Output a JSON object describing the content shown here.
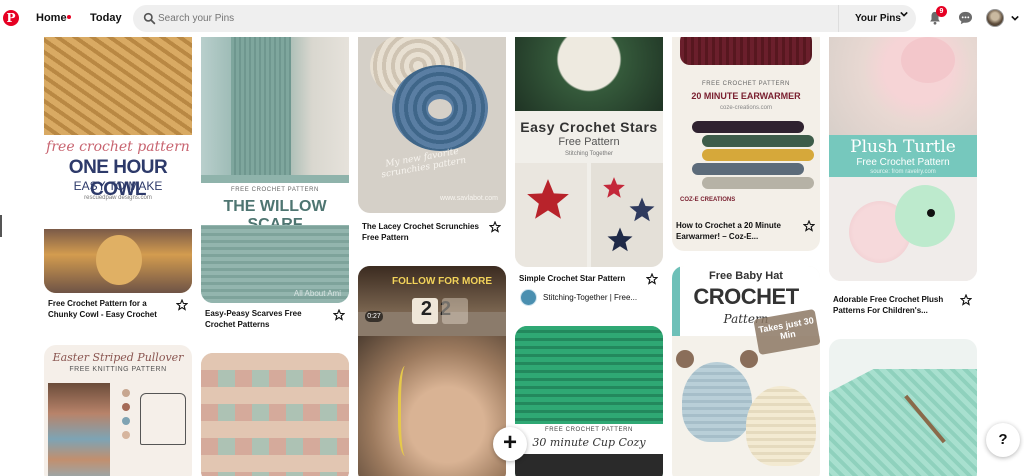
{
  "header": {
    "logo": "P",
    "home_label": "Home",
    "today_label": "Today",
    "search_placeholder": "Search your Pins",
    "your_pins_label": "Your Pins",
    "notification_count": "9"
  },
  "pins": [
    {
      "img_title1": "free crochet pattern",
      "img_title2": "ONE HOUR COWL",
      "img_title3": "EASY TO MAKE",
      "img_source": "rescuedpaw designs.com",
      "caption": "Free Crochet Pattern for a Chunky Cowl - Easy Crochet"
    },
    {
      "img_tag": "FREE CROCHET PATTERN",
      "img_title": "THE WILLOW SCARF",
      "img_watermark": "All About Ami",
      "caption": "Easy-Peasy Scarves Free Crochet Patterns"
    },
    {
      "img_script": "My new favorite scrunchies pattern",
      "img_url": "www.savlabot.com",
      "caption": "The Lacey Crochet Scrunchies Free Pattern"
    },
    {
      "img_title": "Easy Crochet Stars",
      "img_sub1": "Free Pattern",
      "img_sub2": "Stitching Together",
      "caption": "Simple Crochet Star Pattern",
      "board": "Stitching-Together | Free..."
    },
    {
      "img_tag": "FREE CROCHET PATTERN",
      "img_title": "20 MINUTE EARWARMER",
      "img_url": "coze-creations.com",
      "img_brand": "COZ-E CREATIONS",
      "caption": "How to Crochet a 20 Minute Earwarmer! – Coz-E..."
    },
    {
      "img_title": "Plush Turtle",
      "img_sub": "Free Crochet Pattern",
      "img_source": "source: from ravelry.com",
      "caption": "Adorable Free Crochet Plush Patterns For Children's..."
    },
    {
      "img_title": "Easter Striped Pullover",
      "img_sub": "FREE KNITTING PATTERN"
    },
    {
      "video_time": "0:27",
      "follow_text": "FOLLOW FOR MORE",
      "clock_digits": "22"
    },
    {
      "img_tag": "FREE CROCHET PATTERN",
      "img_title": "30 minute Cup Cozy"
    },
    {
      "img_title1": "Free Baby Hat",
      "img_title2": "CROCHET",
      "img_title3": "Pattern",
      "img_badge": "Takes just 30 Min"
    }
  ],
  "colors": {
    "brand": "#e60023",
    "search_bg": "#efefef"
  }
}
